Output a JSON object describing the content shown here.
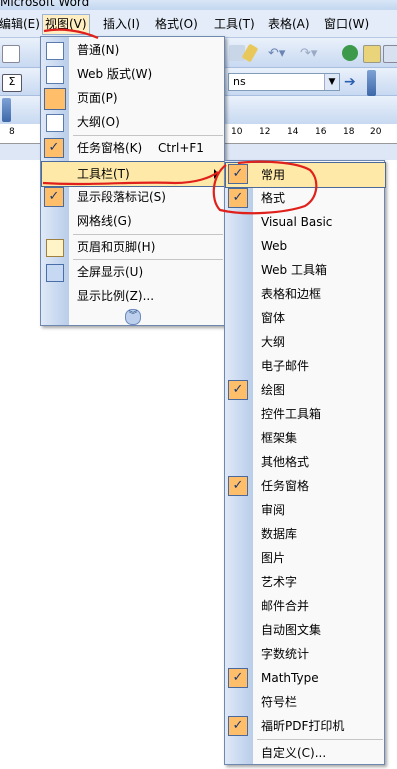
{
  "window": {
    "title": "Microsoft Word"
  },
  "menubar": {
    "items": [
      {
        "label": "编辑(E)"
      },
      {
        "label": "视图(V)"
      },
      {
        "label": "插入(I)"
      },
      {
        "label": "格式(O)"
      },
      {
        "label": "工具(T)"
      },
      {
        "label": "表格(A)"
      },
      {
        "label": "窗口(W)"
      }
    ]
  },
  "toolbar": {
    "font_name": "ns"
  },
  "ruler": {
    "ticks": [
      "8",
      "10",
      "12",
      "14",
      "16",
      "18",
      "20"
    ]
  },
  "view_menu": {
    "items": [
      {
        "label": "普通(N)",
        "icon": "normal-view-icon"
      },
      {
        "label": "Web 版式(W)",
        "icon": "web-layout-icon"
      },
      {
        "label": "页面(P)",
        "icon": "print-layout-icon",
        "checked_icon": true
      },
      {
        "label": "大纲(O)",
        "icon": "outline-view-icon"
      },
      {
        "label": "任务窗格(K)",
        "shortcut": "Ctrl+F1",
        "checked": true
      },
      {
        "label": "工具栏(T)",
        "submenu": true,
        "highlighted": true
      },
      {
        "label": "显示段落标记(S)",
        "checked": true
      },
      {
        "label": "网格线(G)"
      },
      {
        "label": "页眉和页脚(H)",
        "icon": "header-footer-icon"
      },
      {
        "label": "全屏显示(U)",
        "icon": "full-screen-icon"
      },
      {
        "label": "显示比例(Z)..."
      }
    ],
    "expand_icon": "double-chevron-down-icon"
  },
  "toolbars_menu": {
    "items": [
      {
        "label": "常用",
        "checked": true,
        "highlighted": true
      },
      {
        "label": "格式",
        "checked": true
      },
      {
        "label": "Visual Basic",
        "checked": false
      },
      {
        "label": "Web",
        "checked": false
      },
      {
        "label": "Web 工具箱",
        "checked": false
      },
      {
        "label": "表格和边框",
        "checked": false
      },
      {
        "label": "窗体",
        "checked": false
      },
      {
        "label": "大纲",
        "checked": false
      },
      {
        "label": "电子邮件",
        "checked": false
      },
      {
        "label": "绘图",
        "checked": true
      },
      {
        "label": "控件工具箱",
        "checked": false
      },
      {
        "label": "框架集",
        "checked": false
      },
      {
        "label": "其他格式",
        "checked": false
      },
      {
        "label": "任务窗格",
        "checked": true
      },
      {
        "label": "审阅",
        "checked": false
      },
      {
        "label": "数据库",
        "checked": false
      },
      {
        "label": "图片",
        "checked": false
      },
      {
        "label": "艺术字",
        "checked": false
      },
      {
        "label": "邮件合并",
        "checked": false
      },
      {
        "label": "自动图文集",
        "checked": false
      },
      {
        "label": "字数统计",
        "checked": false
      },
      {
        "label": "MathType",
        "checked": true
      },
      {
        "label": "符号栏",
        "checked": false
      },
      {
        "label": "福昕PDF打印机",
        "checked": true
      },
      {
        "label": "自定义(C)...",
        "checked": false
      }
    ]
  },
  "colors": {
    "menu_highlight": "#ffe9a8",
    "check_bg": "#ffbe6a",
    "annotation": "#e0201b"
  }
}
